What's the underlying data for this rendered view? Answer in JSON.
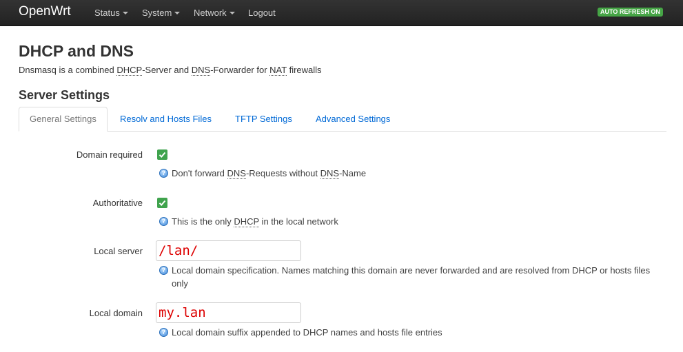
{
  "navbar": {
    "brand": "OpenWrt",
    "items": [
      {
        "label": "Status",
        "dropdown": true
      },
      {
        "label": "System",
        "dropdown": true
      },
      {
        "label": "Network",
        "dropdown": true
      },
      {
        "label": "Logout",
        "dropdown": false
      }
    ],
    "auto_refresh": "AUTO REFRESH ON"
  },
  "page": {
    "title": "DHCP and DNS",
    "description": {
      "prefix": "Dnsmasq is a combined ",
      "abbr1": "DHCP",
      "mid1": "-Server and ",
      "abbr2": "DNS",
      "mid2": "-Forwarder for ",
      "abbr3": "NAT",
      "suffix": " firewalls"
    }
  },
  "section": {
    "title": "Server Settings",
    "tabs": [
      {
        "label": "General Settings",
        "active": true
      },
      {
        "label": "Resolv and Hosts Files",
        "active": false
      },
      {
        "label": "TFTP Settings",
        "active": false
      },
      {
        "label": "Advanced Settings",
        "active": false
      }
    ]
  },
  "fields": {
    "domain_required": {
      "label": "Domain required",
      "checked": true,
      "help": {
        "p1": "Don't forward ",
        "abbr1": "DNS",
        "p2": "-Requests without ",
        "abbr2": "DNS",
        "p3": "-Name"
      }
    },
    "authoritative": {
      "label": "Authoritative",
      "checked": true,
      "help": {
        "p1": "This is the only ",
        "abbr1": "DHCP",
        "p2": " in the local network"
      }
    },
    "local_server": {
      "label": "Local server",
      "value": "/lan/",
      "help": "Local domain specification. Names matching this domain are never forwarded and are resolved from DHCP or hosts files only"
    },
    "local_domain": {
      "label": "Local domain",
      "value": "my.lan",
      "help": "Local domain suffix appended to DHCP names and hosts file entries"
    }
  },
  "colors": {
    "navbar_bg": "#222222",
    "badge": "#46a546",
    "link": "#0069d6",
    "checkbox": "#3fa34d",
    "input_text": "#dd0000"
  },
  "icons": {
    "checkbox": "check-icon",
    "help": "help-icon",
    "dropdown": "caret-down-icon"
  }
}
